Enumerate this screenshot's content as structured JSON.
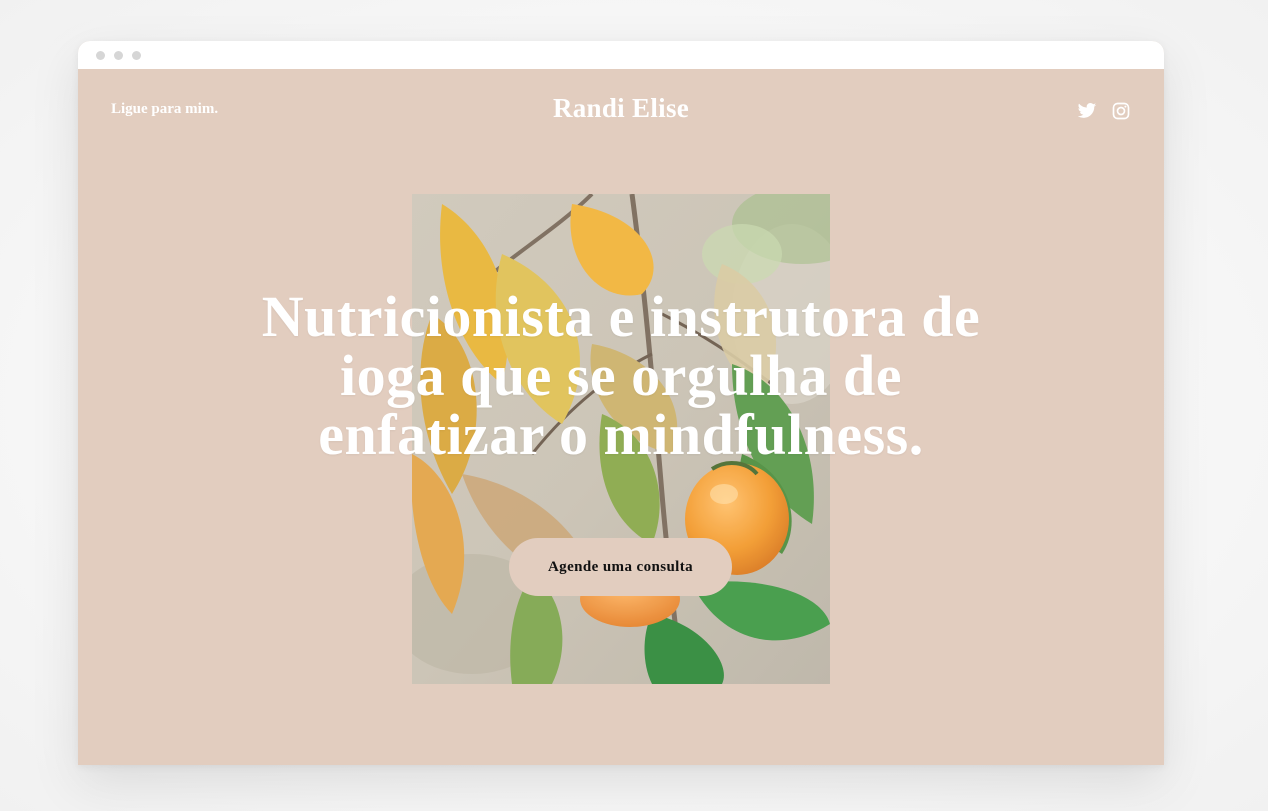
{
  "header": {
    "phone_link": "Ligue para mim.",
    "brand": "Randi Elise",
    "social_icons": [
      "twitter-icon",
      "instagram-icon"
    ]
  },
  "hero": {
    "headline": "Nutricionista e instrutora de ioga que se orgulha de enfatizar o mindfulness.",
    "cta_label": "Agende uma consulta",
    "image_subject": "persimmon branch with leaves and orange fruits"
  },
  "colors": {
    "background": "#e2cdbf",
    "text": "#ffffff",
    "button_bg": "#e2cdbf",
    "button_text": "#111111"
  }
}
